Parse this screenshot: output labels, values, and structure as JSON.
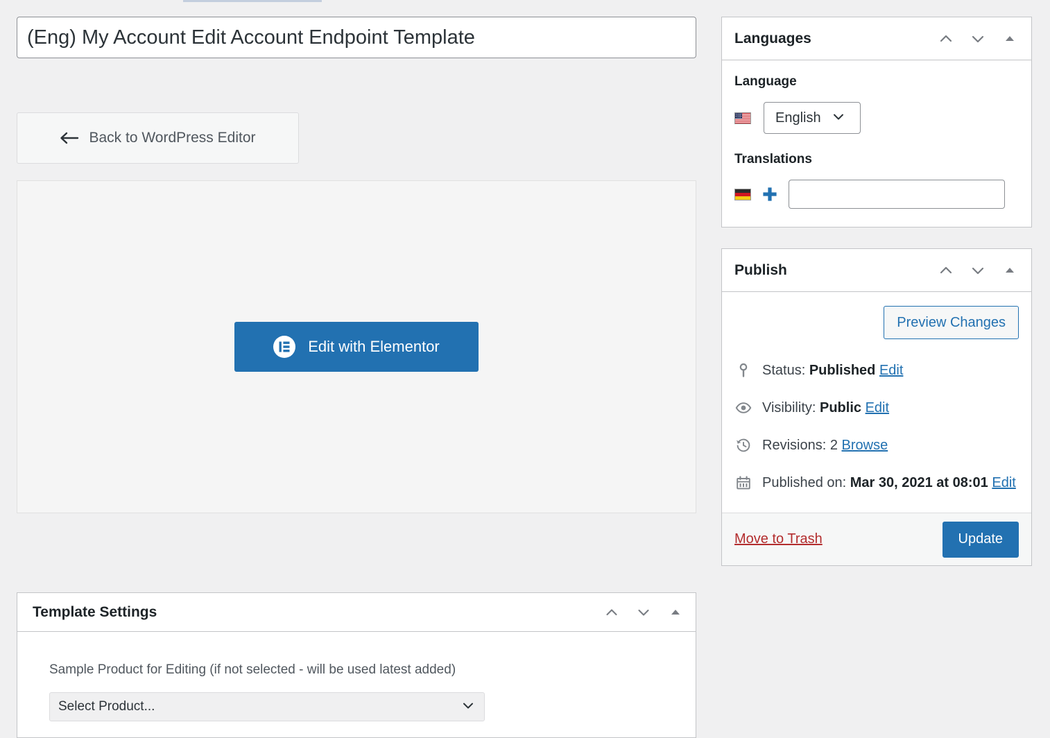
{
  "page": {
    "background_color": "#f0f0f1",
    "accent_color": "#2271b1",
    "danger_color": "#b32d2e"
  },
  "editor": {
    "title_value": "(Eng) My Account Edit Account Endpoint Template",
    "title_placeholder": "Add title",
    "back_button_label": "Back to WordPress Editor",
    "back_button_icon": "arrow-left-icon",
    "elementor_button_label": "Edit with Elementor",
    "elementor_logo_icon": "elementor-logo-icon"
  },
  "template_settings": {
    "panel_title": "Template Settings",
    "move_up_icon": "chevron-up-icon",
    "move_down_icon": "chevron-down-icon",
    "toggle_icon": "triangle-up-icon",
    "field_label": "Sample Product for Editing (if not selected - will be used latest added)",
    "select_value": "Select Product...",
    "select_caret_icon": "chevron-down-icon",
    "select_options": [
      "Select Product..."
    ]
  },
  "languages": {
    "panel_title": "Languages",
    "move_up_icon": "chevron-up-icon",
    "move_down_icon": "chevron-down-icon",
    "toggle_icon": "triangle-up-icon",
    "language_label": "Language",
    "current_language": "English",
    "current_language_flag_icon": "flag-us-icon",
    "language_caret_icon": "chevron-down-icon",
    "language_options": [
      "English"
    ],
    "translations_label": "Translations",
    "translation_flag_icon": "flag-de-icon",
    "add_translation_icon": "plus-icon",
    "translation_input_value": "",
    "translation_input_placeholder": ""
  },
  "publish": {
    "panel_title": "Publish",
    "move_up_icon": "chevron-up-icon",
    "move_down_icon": "chevron-down-icon",
    "toggle_icon": "triangle-up-icon",
    "preview_changes_label": "Preview Changes",
    "rows": [
      {
        "icon": "post-status-pin-icon",
        "prefix": "Status: ",
        "value": "Published",
        "link": "Edit"
      },
      {
        "icon": "visibility-eye-icon",
        "prefix": "Visibility: ",
        "value": "Public",
        "link": "Edit"
      },
      {
        "icon": "revisions-clock-icon",
        "prefix": "Revisions: ",
        "value": "2",
        "link": "Browse"
      },
      {
        "icon": "calendar-icon",
        "prefix": "Published on: ",
        "value": "Mar 30, 2021 at 08:01",
        "link": "Edit"
      }
    ],
    "move_to_trash_label": "Move to Trash",
    "update_label": "Update"
  }
}
